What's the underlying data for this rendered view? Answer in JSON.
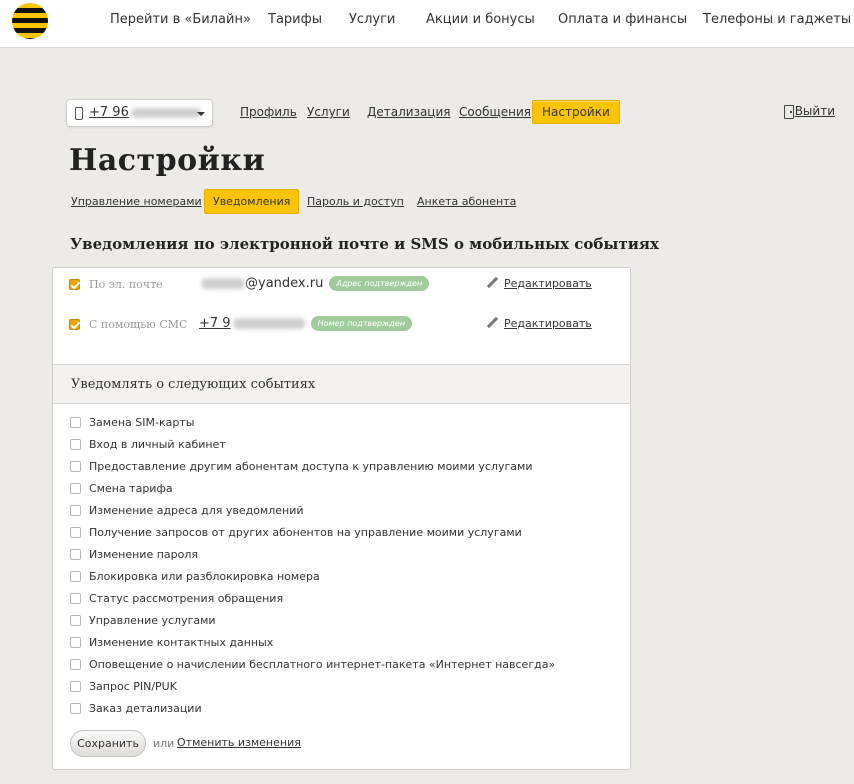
{
  "colors": {
    "brand_yellow": "#fdc403",
    "badge_green": "#9fcc9a",
    "checkbox_checked": "#e9a800"
  },
  "top_nav": [
    "Перейти в «Билайн»",
    "Тарифы",
    "Услуги",
    "Акции и бонусы",
    "Оплата и финансы",
    "Телефоны и гаджеты"
  ],
  "account": {
    "phone_prefix": "+7 96",
    "dropdown_icon": "chevron-down-icon"
  },
  "sub_nav": [
    "Профиль",
    "Услуги",
    "Детализация",
    "Сообщения",
    "Настройки"
  ],
  "logout_label": "Выйти",
  "page_title": "Настройки",
  "tabs": [
    "Управление номерами",
    "Уведомления",
    "Пароль и доступ",
    "Анкета абонента"
  ],
  "section_title": "Уведомления по электронной почте и SMS о мобильных событиях",
  "contacts": [
    {
      "label": "По эл. почте",
      "value": "@yandex.ru",
      "badge": "Адрес подтвержден",
      "checked": true
    },
    {
      "label": "С помощью СМС",
      "value": "+7 9",
      "badge": "Номер подтвержден",
      "checked": true
    }
  ],
  "edit_label": "Редактировать",
  "events_header": "Уведомлять о следующих событиях",
  "events": [
    "Замена SIM-карты",
    "Вход в личный кабинет",
    "Предоставление другим абонентам доступа к управлению моими услугами",
    "Смена тарифа",
    "Изменение адреса для уведомлений",
    "Получение запросов от других абонентов на управление моими услугами",
    "Изменение пароля",
    "Блокировка или разблокировка номера",
    "Статус рассмотрения обращения",
    "Управление услугами",
    "Изменение контактных данных",
    "Оповещение о начислении бесплатного интернет-пакета «Интернет навсегда»",
    "Запрос PIN/PUK",
    "Заказ детализации"
  ],
  "save_label": "Сохранить",
  "or_label": "или",
  "cancel_label": "Отменить изменения"
}
